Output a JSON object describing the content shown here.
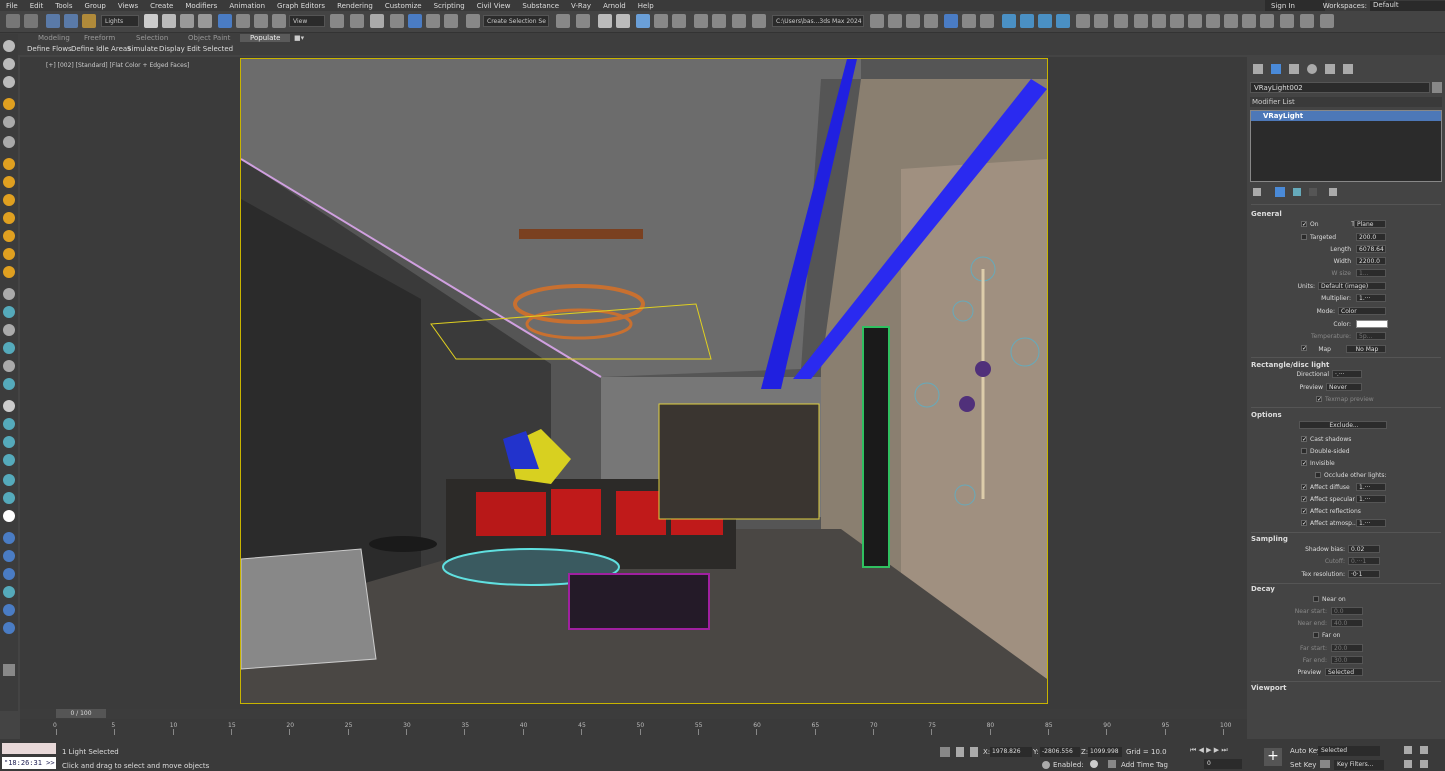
{
  "menu": [
    "File",
    "Edit",
    "Tools",
    "Group",
    "Views",
    "Create",
    "Modifiers",
    "Animation",
    "Graph Editors",
    "Rendering",
    "Customize",
    "Scripting",
    "Civil View",
    "Substance",
    "V-Ray",
    "Arnold",
    "Help"
  ],
  "signin": "Sign In",
  "workspaces_label": "Workspaces:",
  "workspaces_value": "Default",
  "toolbar": {
    "selection_filter": "Lights",
    "ref_coord": "View",
    "selection_set": "Create Selection Se",
    "project_path": "C:\\Users\\bas...3ds Max 2024"
  },
  "ribbon": {
    "tabs": [
      "Modeling",
      "Freeform",
      "Selection",
      "Object Paint",
      "Populate"
    ],
    "subtabs": [
      "Define Flows",
      "Define Idle Areas",
      "Simulate",
      "Display",
      "Edit Selected"
    ]
  },
  "viewport_label": "[+] [002] [Standard] [Flat Color + Edged Faces]",
  "object_name": "VRayLight002",
  "modifier_list": "Modifier List",
  "modifier_stack": [
    "VRayLight"
  ],
  "general": {
    "title": "General",
    "on_label": "On",
    "type_label": "Type:",
    "type_value": "Plane",
    "targeted_label": "Targeted",
    "targeted_value": "200.0",
    "length_label": "Length",
    "length_value": "6078.64",
    "width_label": "Width",
    "width_value": "2200.0",
    "wsize_label": "W size",
    "wsize_value": "1...",
    "units_label": "Units:",
    "units_value": "Default (image)",
    "multiplier_label": "Multiplier:",
    "multiplier_value": "1.···",
    "mode_label": "Mode:",
    "mode_value": "Color",
    "color_label": "Color:",
    "color_hex": "#ffffff",
    "temperature_label": "Temperature:",
    "temperature_value": "5p...",
    "map_label": "Map",
    "map_value": "No Map"
  },
  "rect_disc": {
    "title": "Rectangle/disc light",
    "directional_label": "Directional",
    "directional_value": "·.···",
    "preview_label": "Preview",
    "preview_value": "Never",
    "texmap_label": "Texmap preview"
  },
  "options": {
    "title": "Options",
    "exclude_label": "Exclude...",
    "items": [
      {
        "label": "Cast shadows",
        "checked": true
      },
      {
        "label": "Double-sided",
        "checked": false
      },
      {
        "label": "Invisible",
        "checked": true
      },
      {
        "label": "Occlude other lights:",
        "checked": false
      },
      {
        "label": "Affect diffuse",
        "checked": true,
        "value": "1.···"
      },
      {
        "label": "Affect specular",
        "checked": true,
        "value": "1.···"
      },
      {
        "label": "Affect reflections",
        "checked": true
      },
      {
        "label": "Affect atmosp...",
        "checked": true,
        "value": "1.···"
      }
    ]
  },
  "sampling": {
    "title": "Sampling",
    "shadow_bias_label": "Shadow bias:",
    "shadow_bias_value": "0.02",
    "cutoff_label": "Cutoff:",
    "cutoff_value": "0.···1",
    "texres_label": "Tex resolution:",
    "texres_value": "·0·1"
  },
  "decay": {
    "title": "Decay",
    "near_on": "Near on",
    "near_start_label": "Near start:",
    "near_start_value": "0.0",
    "near_end_label": "Near end:",
    "near_end_value": "40.0",
    "far_on": "Far on",
    "far_start_label": "Far start:",
    "far_start_value": "20.0",
    "far_end_label": "Far end:",
    "far_end_value": "30.0",
    "preview_label": "Preview",
    "preview_value": "Selected"
  },
  "viewport_rollout": "Viewport",
  "timeline": {
    "frame": "0 / 100",
    "ticks": [
      "0",
      "5",
      "10",
      "15",
      "20",
      "25",
      "30",
      "35",
      "40",
      "45",
      "50",
      "55",
      "60",
      "65",
      "70",
      "75",
      "80",
      "85",
      "90",
      "95",
      "100"
    ]
  },
  "status": {
    "time": "\"18:26:31 >>",
    "selected": "1 Light Selected",
    "prompt": "Click and drag to select and move objects",
    "x_label": "X:",
    "x_value": "1978.826",
    "y_label": "Y:",
    "y_value": "-2806.556",
    "z_label": "Z:",
    "z_value": "1099.998",
    "grid": "Grid = 10.0",
    "enabled": "Enabled:",
    "add_time_tag": "Add Time Tag",
    "auto_key": "Auto Key",
    "set_key": "Set Key",
    "selected_dd": "Selected",
    "key_filters": "Key Filters...",
    "frame_value": "0"
  }
}
